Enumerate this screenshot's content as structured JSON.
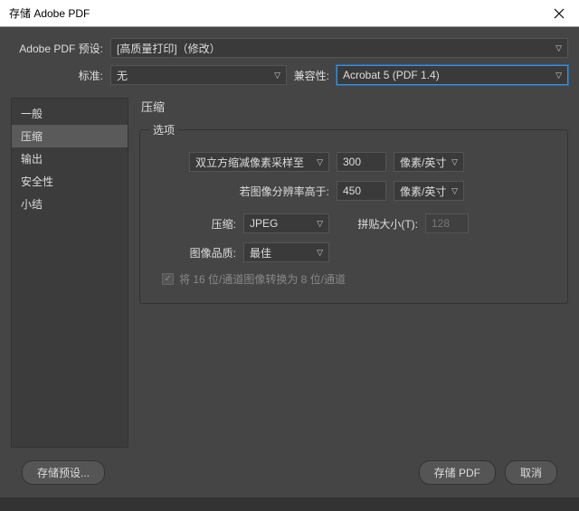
{
  "titlebar": {
    "title": "存储 Adobe PDF"
  },
  "header": {
    "preset_label": "Adobe PDF 预设:",
    "preset_value": "[高质量打印]（修改）",
    "standard_label": "标准:",
    "standard_value": "无",
    "compat_label": "兼容性:",
    "compat_value": "Acrobat 5 (PDF 1.4)"
  },
  "sidebar": {
    "items": [
      {
        "label": "一般"
      },
      {
        "label": "压缩"
      },
      {
        "label": "输出"
      },
      {
        "label": "安全性"
      },
      {
        "label": "小结"
      }
    ],
    "active_index": 1
  },
  "panel": {
    "title": "压缩",
    "group_title": "选项",
    "downsample_method": "双立方缩减像素采样至",
    "downsample_value": "300",
    "downsample_unit": "像素/英寸",
    "threshold_label": "若图像分辨率高于:",
    "threshold_value": "450",
    "threshold_unit": "像素/英寸",
    "compression_label": "压缩:",
    "compression_value": "JPEG",
    "tile_label": "拼贴大小(T):",
    "tile_value": "128",
    "quality_label": "图像品质:",
    "quality_value": "最佳",
    "convert_label": "将 16 位/通道图像转换为 8 位/通道"
  },
  "footer": {
    "save_preset": "存储预设...",
    "save_pdf": "存储 PDF",
    "cancel": "取消"
  }
}
